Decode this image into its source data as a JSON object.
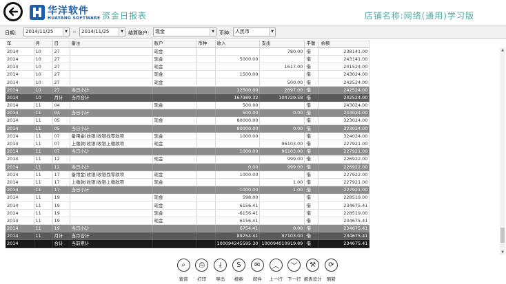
{
  "header": {
    "logo_cn": "华洋软件",
    "logo_en": "HUAYANG SOFTWARE",
    "page_title": "资金日报表",
    "store_label": "店铺名称:网络(通用)学习版"
  },
  "filters": {
    "date_label": "日期:",
    "date_from": "2014/11/25",
    "date_sep": "~",
    "date_to": "2014/11/25",
    "account_label": "结算账户:",
    "account_value": "现金",
    "currency_label": "币种:",
    "currency_value": "人民币"
  },
  "table": {
    "columns": [
      "年",
      "月",
      "日",
      "备注",
      "账户",
      "币种",
      "收入",
      "支出",
      "平衡",
      "余额"
    ],
    "rows": [
      {
        "t": "d",
        "c": [
          "2014",
          "10",
          "27",
          "",
          "现金",
          "",
          "",
          "780.00",
          "借",
          "238141.00"
        ]
      },
      {
        "t": "d",
        "c": [
          "2014",
          "10",
          "27",
          "",
          "现金",
          "",
          "5000.00",
          "",
          "借",
          "243141.00"
        ]
      },
      {
        "t": "d",
        "c": [
          "2014",
          "10",
          "27",
          "",
          "现金",
          "",
          "",
          "1617.00",
          "借",
          "241524.00"
        ]
      },
      {
        "t": "d",
        "c": [
          "2014",
          "10",
          "27",
          "",
          "现金",
          "",
          "1500.00",
          "",
          "借",
          "243024.00"
        ]
      },
      {
        "t": "d",
        "c": [
          "2014",
          "10",
          "27",
          "",
          "现金",
          "",
          "",
          "500.00",
          "借",
          "242524.00"
        ]
      },
      {
        "t": "s",
        "c": [
          "2014",
          "10",
          "27",
          "当日小计",
          "",
          "",
          "12500.00",
          "2897.00",
          "借",
          "242524.00"
        ]
      },
      {
        "t": "m",
        "c": [
          "2014",
          "10",
          "月计",
          "当月合计",
          "",
          "",
          "167989.32",
          "104729.58",
          "借",
          "242524.00"
        ]
      },
      {
        "t": "d",
        "c": [
          "2014",
          "11",
          "04",
          "",
          "现金",
          "",
          "500.00",
          "",
          "借",
          "243024.00"
        ]
      },
      {
        "t": "s",
        "c": [
          "2014",
          "11",
          "04",
          "当日小计",
          "",
          "",
          "500.00",
          "0.00",
          "借",
          "243024.00"
        ]
      },
      {
        "t": "d",
        "c": [
          "2014",
          "11",
          "05",
          "",
          "现金",
          "",
          "80000.00",
          "",
          "借",
          "323024.00"
        ]
      },
      {
        "t": "s",
        "c": [
          "2014",
          "11",
          "05",
          "当日小计",
          "",
          "",
          "80000.00",
          "0.00",
          "借",
          "323024.00"
        ]
      },
      {
        "t": "d",
        "c": [
          "2014",
          "11",
          "07",
          "备用金(收银)收银找零款项",
          "现金",
          "",
          "1000.00",
          "",
          "借",
          "324024.00"
        ]
      },
      {
        "t": "d",
        "c": [
          "2014",
          "11",
          "07",
          "上缴款(收银)收银上缴款项",
          "现金",
          "",
          "",
          "96103.00",
          "借",
          "227921.00"
        ]
      },
      {
        "t": "s",
        "c": [
          "2014",
          "11",
          "07",
          "当日小计",
          "",
          "",
          "1000.00",
          "96103.00",
          "借",
          "227921.00"
        ]
      },
      {
        "t": "d",
        "c": [
          "2014",
          "11",
          "12",
          "",
          "现金",
          "",
          "",
          "999.00",
          "借",
          "226922.00"
        ]
      },
      {
        "t": "s",
        "c": [
          "2014",
          "11",
          "12",
          "当日小计",
          "",
          "",
          "0.00",
          "999.00",
          "借",
          "226922.00"
        ]
      },
      {
        "t": "d",
        "c": [
          "2014",
          "11",
          "17",
          "备用金(收银)收银找零款项",
          "现金",
          "",
          "1000.00",
          "",
          "借",
          "227922.00"
        ]
      },
      {
        "t": "d",
        "c": [
          "2014",
          "11",
          "17",
          "上缴款(收银)收银上缴款项",
          "现金",
          "",
          "",
          "1.00",
          "借",
          "227921.00"
        ]
      },
      {
        "t": "s",
        "c": [
          "2014",
          "11",
          "17",
          "当日小计",
          "",
          "",
          "1000.00",
          "1.00",
          "借",
          "227921.00"
        ]
      },
      {
        "t": "d",
        "c": [
          "2014",
          "11",
          "19",
          "",
          "现金",
          "",
          "598.00",
          "",
          "借",
          "228519.00"
        ]
      },
      {
        "t": "d",
        "c": [
          "2014",
          "11",
          "19",
          "",
          "现金",
          "",
          "6156.41",
          "",
          "借",
          "234675.41"
        ]
      },
      {
        "t": "d",
        "c": [
          "2014",
          "11",
          "19",
          "",
          "现金",
          "",
          "-6156.41",
          "",
          "借",
          "228519.00"
        ]
      },
      {
        "t": "d",
        "c": [
          "2014",
          "11",
          "19",
          "",
          "现金",
          "",
          "6156.41",
          "",
          "借",
          "234675.41"
        ]
      },
      {
        "t": "s",
        "c": [
          "2014",
          "11",
          "19",
          "当日小计",
          "",
          "",
          "6754.41",
          "0.00",
          "借",
          "234675.41"
        ]
      },
      {
        "t": "m",
        "c": [
          "2014",
          "11",
          "月计",
          "当月合计",
          "",
          "",
          "89254.41",
          "97103.00",
          "借",
          "234675.41"
        ]
      },
      {
        "t": "z",
        "c": [
          "2014",
          "",
          "合计",
          "当前累计",
          "",
          "",
          "100094245595.30",
          "100094010919.89",
          "借",
          "234675.41"
        ]
      }
    ]
  },
  "toolbar": [
    {
      "id": "query",
      "label": "查询",
      "icon": "magnifier-icon",
      "glyph": "⌕"
    },
    {
      "id": "print",
      "label": "打印",
      "icon": "printer-icon",
      "glyph": "⎙"
    },
    {
      "id": "export",
      "label": "导出",
      "icon": "export-icon",
      "glyph": "⤓"
    },
    {
      "id": "search",
      "label": "搜索",
      "icon": "search-s-icon",
      "glyph": "S"
    },
    {
      "id": "mail",
      "label": "邮件",
      "icon": "envelope-icon",
      "glyph": "✉"
    },
    {
      "id": "prev",
      "label": "上一行",
      "icon": "chevron-up-icon",
      "glyph": "︿"
    },
    {
      "id": "next",
      "label": "下一行",
      "icon": "chevron-down-icon",
      "glyph": "﹀"
    },
    {
      "id": "design",
      "label": "报表设计",
      "icon": "hammer-icon",
      "glyph": "⚒"
    },
    {
      "id": "refresh",
      "label": "刷新",
      "icon": "refresh-icon",
      "glyph": "⟳"
    }
  ]
}
